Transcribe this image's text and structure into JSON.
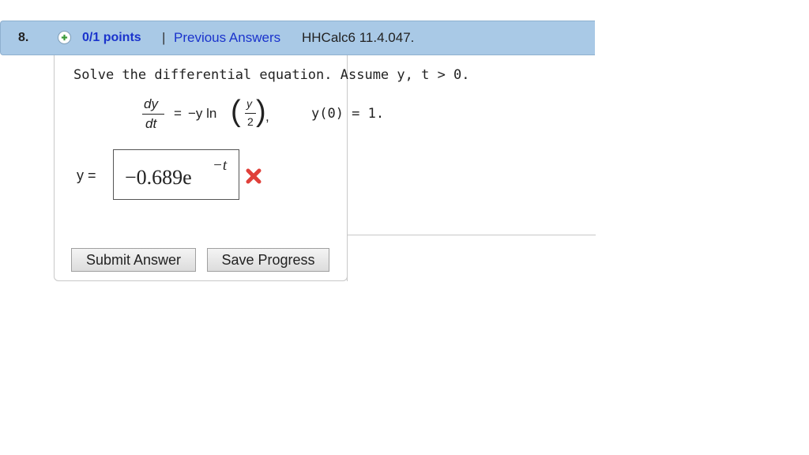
{
  "question": {
    "number": "8.",
    "points": "0/1 points",
    "separator": "|",
    "previous_answers": "Previous Answers",
    "id": "HHCalc6 11.4.047."
  },
  "prompt": "Solve the differential equation. Assume y, t > 0.",
  "equation": {
    "lhs_num": "dy",
    "lhs_den": "dt",
    "equals": "=",
    "rhs": "−y ln",
    "arg_num": "y",
    "arg_den": "2",
    "comma": ",",
    "initial": "y(0) = 1."
  },
  "answer": {
    "label": "y =",
    "value_base": "−0.689e",
    "value_exp": "−t",
    "status": "incorrect",
    "status_icon": "x-mark-icon",
    "status_color": "#e0403a"
  },
  "buttons": {
    "submit": "Submit Answer",
    "save": "Save Progress"
  },
  "colors": {
    "header_bg": "#a9c9e6",
    "link": "#1a33cc",
    "plus_icon": "#3a9a3a"
  }
}
